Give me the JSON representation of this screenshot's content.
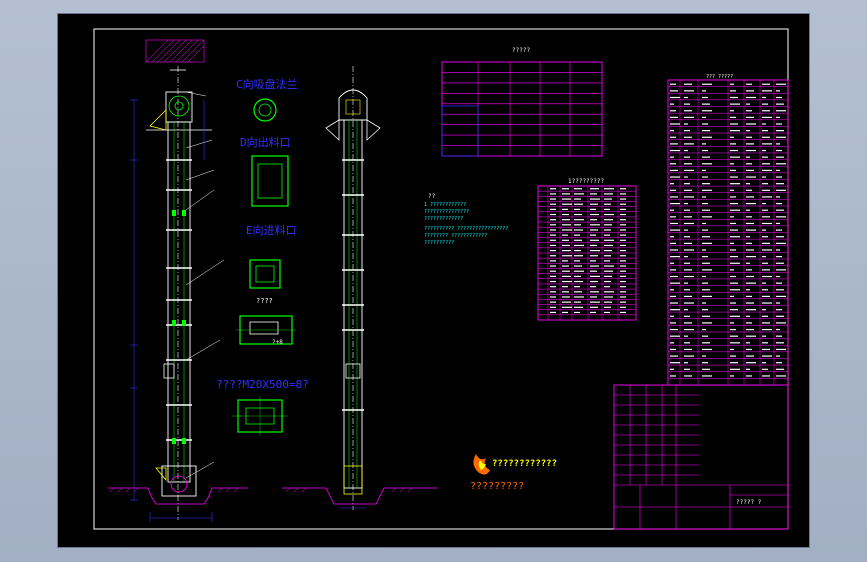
{
  "labels": {
    "top_flange_title": "C向吸盘法兰",
    "mid_port_title": "D向出料口",
    "lower_port_title": "E向进料口",
    "detail_caption": "????",
    "bolt_note": "????M20X500=8?",
    "dim_note": "?+8",
    "table1_title": "?????",
    "table2_title": "1?????????",
    "table3_title": "??? ?????",
    "tech_title": "??",
    "tech_line_1": "1  ????????????",
    "tech_line_2": "   ???????????????",
    "tech_line_3": "   ?????????????",
    "tech_line_4": "?????????? ?????????????????",
    "tech_line_5": "???????? ????????????",
    "tech_line_6": "          ??????????",
    "logo_text": "????????????",
    "logo_sub": "?????????",
    "titleblock_name": "?????  ?"
  },
  "colors": {
    "background": "#000000",
    "magenta": "#ff00ff",
    "green": "#00ff00",
    "cyan": "#00ffff",
    "white": "#ffffff",
    "yellow": "#ffff00",
    "blue": "#3030ff",
    "orange": "#ff6a00"
  }
}
